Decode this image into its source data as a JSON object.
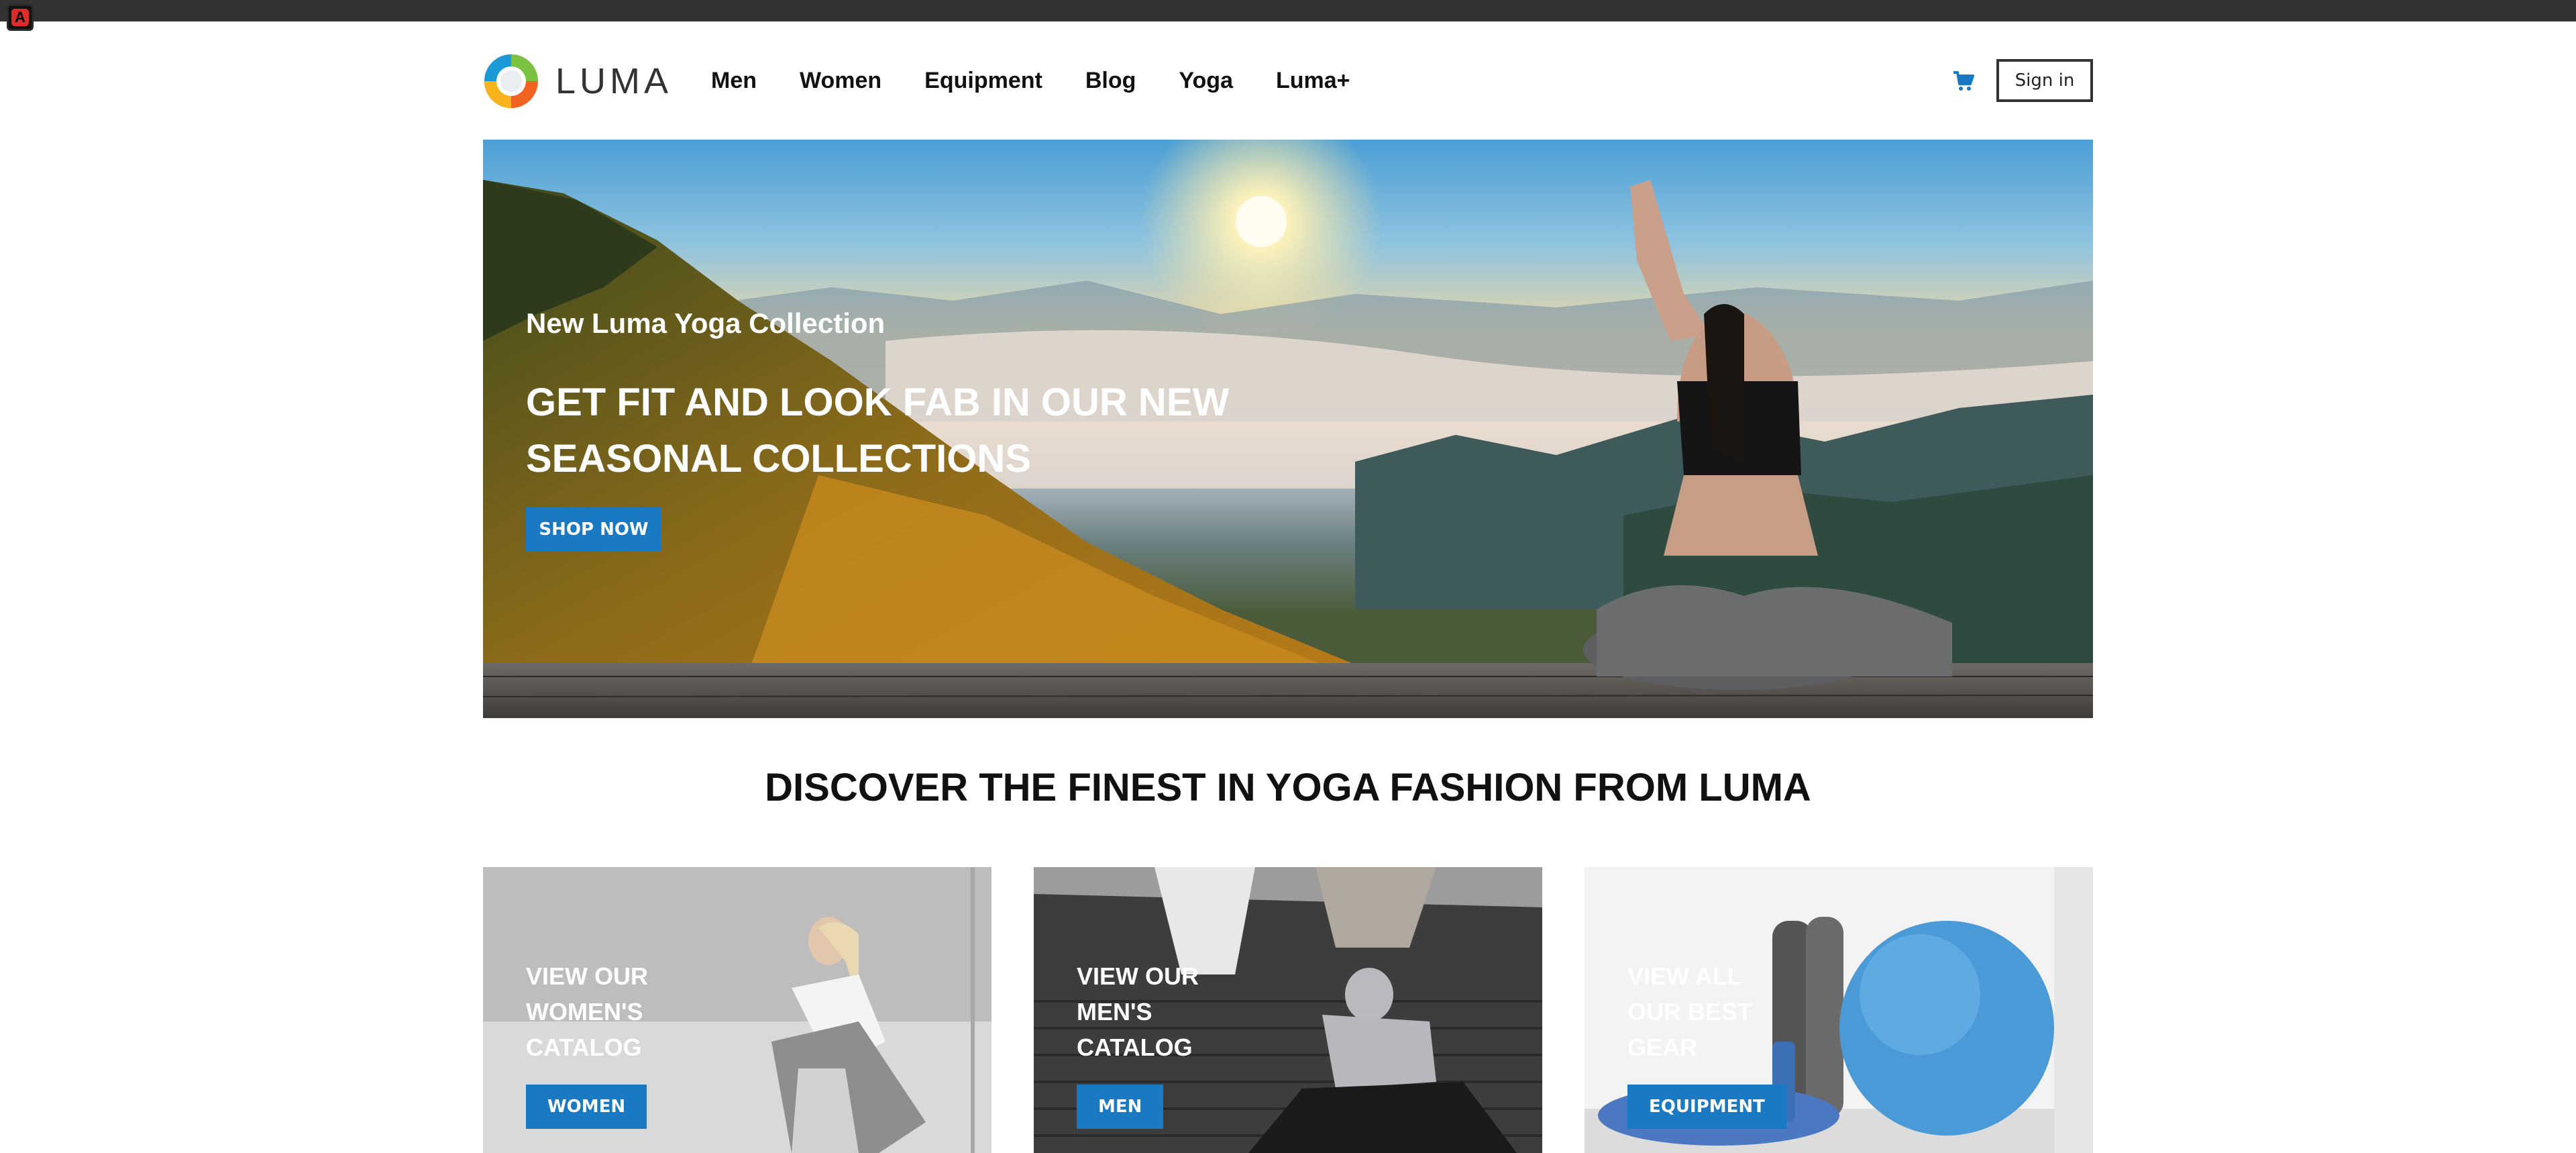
{
  "brand": {
    "name": "LUMA"
  },
  "nav": {
    "items": [
      "Men",
      "Women",
      "Equipment",
      "Blog",
      "Yoga",
      "Luma+"
    ]
  },
  "header": {
    "cart_icon": "cart-icon",
    "signin_label": "Sign in"
  },
  "hero": {
    "subtitle": "New Luma Yoga Collection",
    "title": "GET FIT AND LOOK FAB IN OUR NEW SEASONAL COLLECTIONS",
    "button_label": "SHOP NOW"
  },
  "discover": {
    "heading": "DISCOVER THE FINEST IN YOGA FASHION FROM LUMA"
  },
  "cards": [
    {
      "text": "VIEW OUR WOMEN'S CATALOG",
      "button_label": "WOMEN"
    },
    {
      "text": "VIEW OUR MEN'S CATALOG",
      "button_label": "MEN"
    },
    {
      "text": "VIEW ALL OUR BEST GEAR",
      "button_label": "EQUIPMENT"
    }
  ],
  "colors": {
    "accent": "#1979c3",
    "top_bar": "#333333"
  }
}
